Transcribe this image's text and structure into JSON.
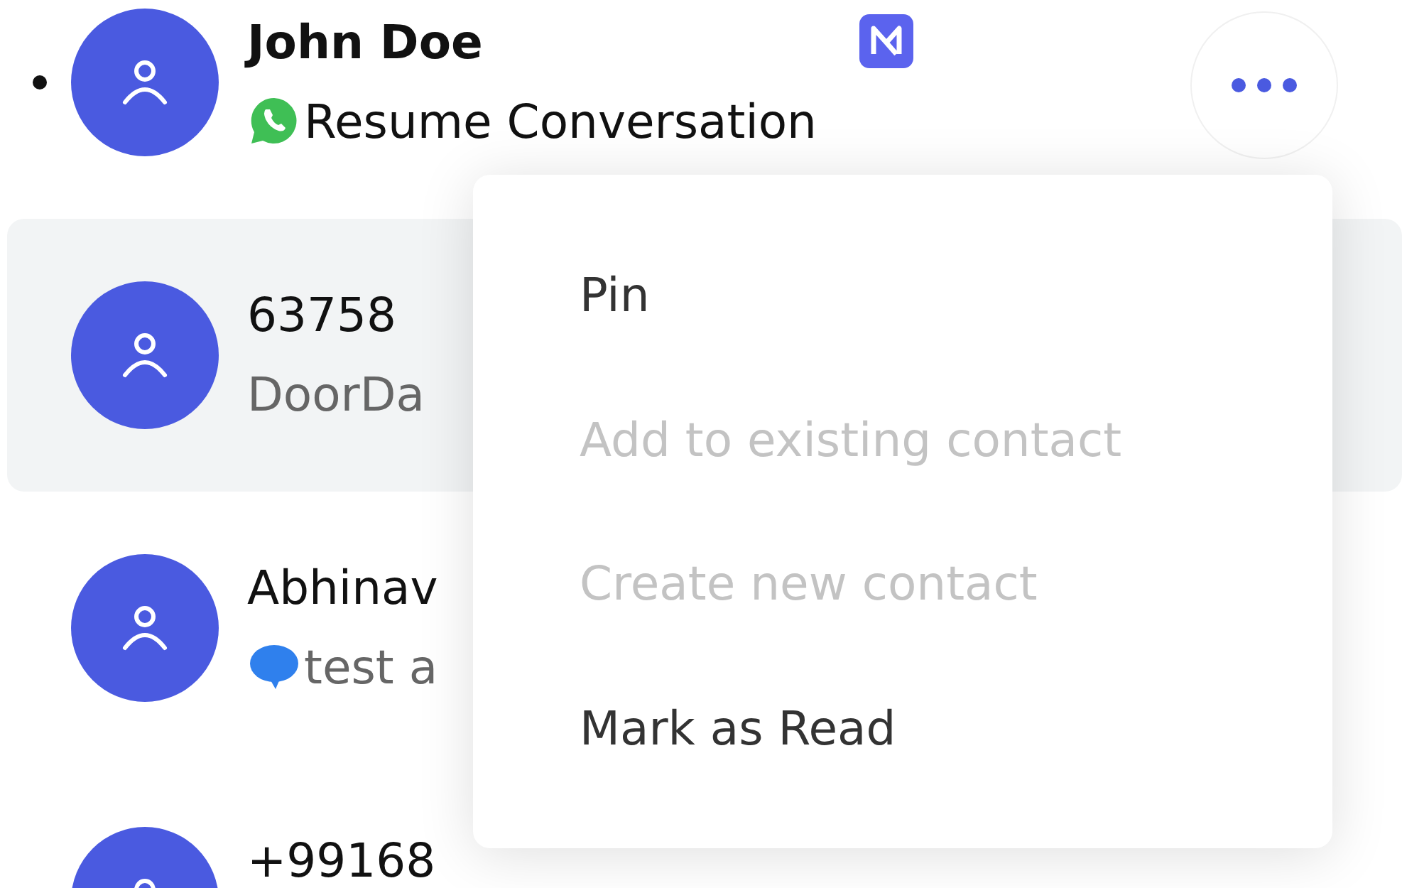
{
  "conversations": [
    {
      "name": "John Doe",
      "unread": true,
      "selected": false,
      "badge": true,
      "preview": {
        "kind": "whatsapp",
        "text": "Resume Conversation"
      },
      "more_button": true
    },
    {
      "name": "63758",
      "unread": false,
      "selected": true,
      "preview": {
        "kind": "plain",
        "text": "DoorDa"
      }
    },
    {
      "name": "Abhinav",
      "unread": false,
      "selected": false,
      "preview": {
        "kind": "sms",
        "text": "test a"
      }
    },
    {
      "name": "+99168",
      "unread": false,
      "selected": false
    }
  ],
  "context_menu": {
    "items": [
      {
        "label": "Pin",
        "disabled": false
      },
      {
        "label": "Add to existing contact",
        "disabled": true
      },
      {
        "label": "Create new contact",
        "disabled": true
      },
      {
        "label": "Mark as Read",
        "disabled": false
      }
    ]
  }
}
